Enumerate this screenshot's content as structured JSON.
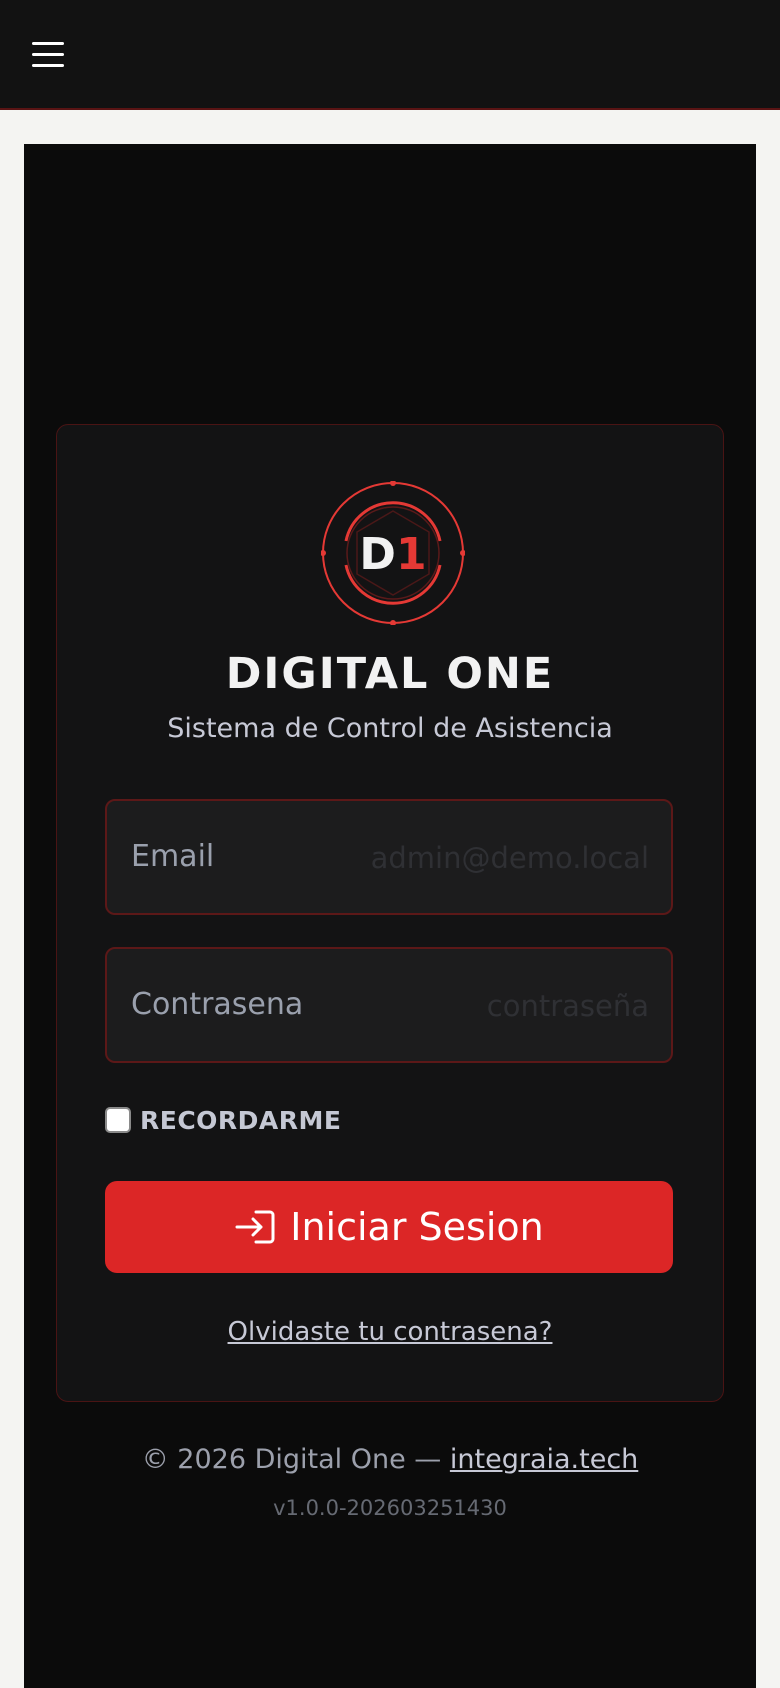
{
  "header": {
    "menu_icon": "hamburger-menu-icon"
  },
  "brand": {
    "logo_text": "D1",
    "logo_digit_color": "#e53935",
    "name": "DIGITAL ONE",
    "tagline": "Sistema de Control de Asistencia"
  },
  "form": {
    "email_label": "Email",
    "email_placeholder": "admin@demo.local",
    "password_label": "Contrasena",
    "password_placeholder": "contraseña",
    "remember_label": "RECORDARME",
    "remember_checked": false,
    "submit_label": "Iniciar Sesion",
    "submit_icon": "login-icon",
    "forgot_link": "Olvidaste tu contrasena?"
  },
  "footer": {
    "copyright": "© 2026 Digital One — ",
    "link_text": "integraia.tech",
    "version": "v1.0.0-202603251430"
  },
  "colors": {
    "accent": "#dc2626",
    "background": "#0b0b0b",
    "card": "#131314"
  }
}
